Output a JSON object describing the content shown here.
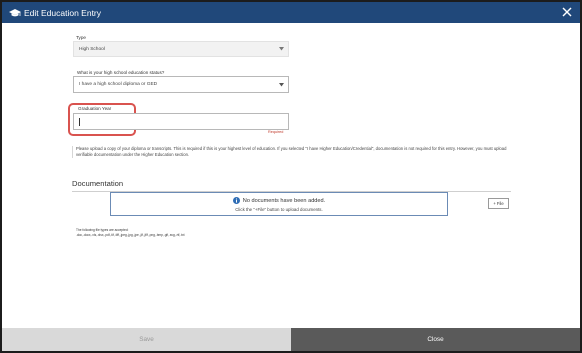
{
  "dialog": {
    "title": "Edit Education Entry"
  },
  "form": {
    "type_label": "Type",
    "type_value": "High School",
    "status_label": "What is your high school education status?",
    "status_value": "I have a high school diploma or GED",
    "grad_year_label": "Graduation Year",
    "grad_year_value": "",
    "required_text": "Required",
    "note_text": "Please upload a copy of your diploma or transcripts. This is required if this is your highest level of education. If you selected \"I have Higher Education/Credential\", documentation is not required for this entry. However, you must upload verifiable documentation under the Higher Education section."
  },
  "documentation": {
    "heading": "Documentation",
    "empty_title": "No documents have been added.",
    "empty_hint": "Click the \"+File\" button to upload documents.",
    "add_file_label": "+ File",
    "filetypes_intro": "The following file types are accepted:",
    "filetypes_list": ".doc,.docx,.xls,.xlsx,.pdf,.tif,.tiff,.jpeg,.jpg,.jpe,.jif,.jfif,.png,.bmp,.gif,.svg,.rtf,.txt"
  },
  "footer": {
    "save_label": "Save",
    "close_label": "Close"
  },
  "icons": {
    "title_icon": "graduation-cap-icon",
    "close_icon": "close-icon",
    "info_icon": "info-icon"
  },
  "colors": {
    "titlebar": "#20487a",
    "highlight": "#d9534f",
    "info": "#2f6db5",
    "close_button": "#5a5a5a",
    "save_button": "#d9d9d9"
  }
}
